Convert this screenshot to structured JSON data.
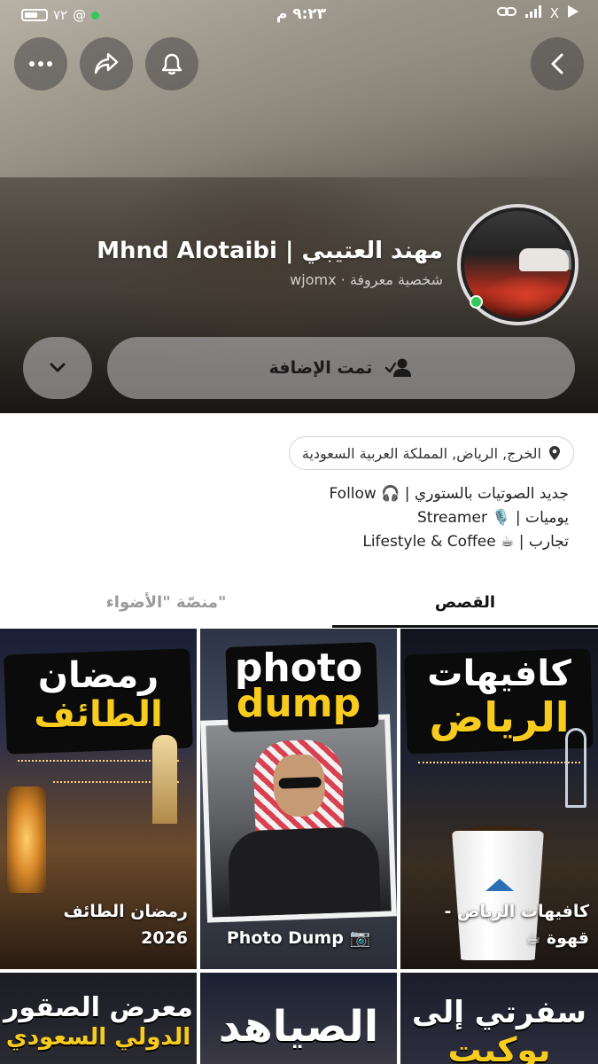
{
  "status_bar": {
    "time": "٩:٢٣ م",
    "battery_text": "٧٢",
    "right_icons": "X"
  },
  "profile": {
    "name": "مهند العتيبي | Mhnd Alotaibi",
    "username": "wjomx",
    "separator": "·",
    "category": "شخصية معروفة",
    "online": true
  },
  "actions": {
    "added_label": "تمت الإضافة"
  },
  "location": "الخرج, الرياض, المملكة العربية السعودية",
  "bio": [
    "جديد الصوتيات بالستوري | 🎧 Follow",
    "يوميات | 🎙️ Streamer",
    "تجارب | ☕ Lifestyle & Coffee"
  ],
  "tabs": [
    {
      "label": "القصص",
      "active": true
    },
    {
      "label": "منصّة \"الأضواء\"",
      "active": false
    }
  ],
  "stories": [
    {
      "title_white": "رمضان",
      "title_yellow": "الطائف",
      "caption_line1": "رمضان الطائف",
      "caption_line2": "2026"
    },
    {
      "title_white": "photo",
      "title_yellow": "dump",
      "caption_line1": "📷 Photo Dump",
      "caption_line2": ""
    },
    {
      "title_white": "كافيهات",
      "title_yellow": "الرياض",
      "caption_line1": "كافيهات الرياض -",
      "caption_line2": "قهوة ☕"
    },
    {
      "title_white": "معرض الصقور",
      "title_yellow": "الدولي السعودي"
    },
    {
      "title_white": "الصياهد",
      "title_yellow": ""
    },
    {
      "title_white": "سفرتي إلى",
      "title_yellow": "بوكيت"
    }
  ],
  "colors": {
    "online": "#34c759",
    "accent_yellow": "#f7cc1e"
  }
}
